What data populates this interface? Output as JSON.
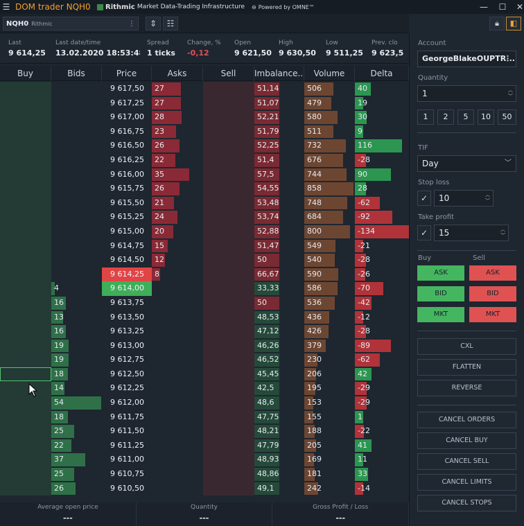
{
  "titlebar": {
    "menu_icon": "hamburger-icon",
    "title": "DOM trader NQH0",
    "rithmic_brand": "Rithmic",
    "rithmic_tagline": "Market Data-Trading Infrastructure",
    "omne": "Powered by OMNE™"
  },
  "toolbar": {
    "symbol": "NQH0",
    "connection": "Rithmic"
  },
  "stats": [
    {
      "label": "Last",
      "value": "9 614,25"
    },
    {
      "label": "Last date/time",
      "value": "13.02.2020 18:53:48"
    },
    {
      "label": "Spread",
      "value": "1 ticks"
    },
    {
      "label": "Change, %",
      "value": "-0,12"
    },
    {
      "label": "Open",
      "value": "9 621,50"
    },
    {
      "label": "High",
      "value": "9 630,50"
    },
    {
      "label": "Low",
      "value": "9 511,25"
    },
    {
      "label": "Prev. clo",
      "value": "9 623,5"
    }
  ],
  "columns": [
    "Buy",
    "Bids",
    "Price",
    "Asks",
    "Sell",
    "Imbalance...",
    "Volume",
    "Delta"
  ],
  "colors": {
    "ask_bar": "#8a2a36",
    "bid_bar": "#2f7048",
    "imb_bar": "#7a2a32",
    "vol_bar": "#6d4632",
    "delta_pos": "#2c9650",
    "delta_neg": "#b0333a",
    "last_price": "#e04545",
    "best_bid": "#3fae58"
  },
  "rows": [
    {
      "price": "9 617,50",
      "bids": "",
      "asks": "27",
      "imb": "51,14",
      "vol": "506",
      "delta": "40"
    },
    {
      "price": "9 617,25",
      "bids": "",
      "asks": "27",
      "imb": "51,07",
      "vol": "479",
      "delta": "19"
    },
    {
      "price": "9 617,00",
      "bids": "",
      "asks": "28",
      "imb": "52,21",
      "vol": "580",
      "delta": "30"
    },
    {
      "price": "9 616,75",
      "bids": "",
      "asks": "23",
      "imb": "51,79",
      "vol": "511",
      "delta": "9"
    },
    {
      "price": "9 616,50",
      "bids": "",
      "asks": "26",
      "imb": "52,25",
      "vol": "732",
      "delta": "116"
    },
    {
      "price": "9 616,25",
      "bids": "",
      "asks": "22",
      "imb": "51,4",
      "vol": "676",
      "delta": "-28"
    },
    {
      "price": "9 616,00",
      "bids": "",
      "asks": "35",
      "imb": "57,5",
      "vol": "744",
      "delta": "90"
    },
    {
      "price": "9 615,75",
      "bids": "",
      "asks": "26",
      "imb": "54,55",
      "vol": "858",
      "delta": "28"
    },
    {
      "price": "9 615,50",
      "bids": "",
      "asks": "21",
      "imb": "53,48",
      "vol": "748",
      "delta": "-62"
    },
    {
      "price": "9 615,25",
      "bids": "",
      "asks": "24",
      "imb": "53,74",
      "vol": "684",
      "delta": "-92"
    },
    {
      "price": "9 615,00",
      "bids": "",
      "asks": "20",
      "imb": "52,88",
      "vol": "800",
      "delta": "-134"
    },
    {
      "price": "9 614,75",
      "bids": "",
      "asks": "15",
      "imb": "51,47",
      "vol": "549",
      "delta": "-21"
    },
    {
      "price": "9 614,50",
      "bids": "",
      "asks": "12",
      "imb": "50",
      "vol": "540",
      "delta": "-28"
    },
    {
      "price": "9 614,25",
      "bids": "",
      "asks": "8",
      "imb": "66,67",
      "vol": "590",
      "delta": "-26",
      "hl": "last"
    },
    {
      "price": "9 614,00",
      "bids": "4",
      "asks": "",
      "imb": "33,33",
      "vol": "586",
      "delta": "-70",
      "hl": "bid"
    },
    {
      "price": "9 613,75",
      "bids": "16",
      "asks": "",
      "imb": "50",
      "vol": "536",
      "delta": "-42"
    },
    {
      "price": "9 613,50",
      "bids": "13",
      "asks": "",
      "imb": "48,53",
      "vol": "436",
      "delta": "-12"
    },
    {
      "price": "9 613,25",
      "bids": "16",
      "asks": "",
      "imb": "47,12",
      "vol": "426",
      "delta": "-28"
    },
    {
      "price": "9 613,00",
      "bids": "19",
      "asks": "",
      "imb": "46,26",
      "vol": "379",
      "delta": "-89"
    },
    {
      "price": "9 612,75",
      "bids": "19",
      "asks": "",
      "imb": "46,52",
      "vol": "230",
      "delta": "-62"
    },
    {
      "price": "9 612,50",
      "bids": "18",
      "asks": "",
      "imb": "45,45",
      "vol": "206",
      "delta": "42",
      "sel": true
    },
    {
      "price": "9 612,25",
      "bids": "14",
      "asks": "",
      "imb": "42,5",
      "vol": "195",
      "delta": "-29"
    },
    {
      "price": "9 612,00",
      "bids": "54",
      "asks": "",
      "imb": "48,6",
      "vol": "153",
      "delta": "-29"
    },
    {
      "price": "9 611,75",
      "bids": "18",
      "asks": "",
      "imb": "47,75",
      "vol": "155",
      "delta": "1"
    },
    {
      "price": "9 611,50",
      "bids": "25",
      "asks": "",
      "imb": "48,21",
      "vol": "188",
      "delta": "-22"
    },
    {
      "price": "9 611,25",
      "bids": "22",
      "asks": "",
      "imb": "47,79",
      "vol": "205",
      "delta": "41"
    },
    {
      "price": "9 611,00",
      "bids": "37",
      "asks": "",
      "imb": "48,93",
      "vol": "169",
      "delta": "11"
    },
    {
      "price": "9 610,75",
      "bids": "25",
      "asks": "",
      "imb": "48,86",
      "vol": "181",
      "delta": "33"
    },
    {
      "price": "9 610,50",
      "bids": "26",
      "asks": "",
      "imb": "49,1",
      "vol": "242",
      "delta": "-14"
    }
  ],
  "footer": [
    {
      "label": "Average open price",
      "value": "---"
    },
    {
      "label": "Quantity",
      "value": "---"
    },
    {
      "label": "Gross Profit / Loss",
      "value": "---"
    }
  ],
  "side": {
    "account_label": "Account",
    "account_value": "GeorgeBlakeOUPTR...",
    "quantity_label": "Quantity",
    "quantity_value": "1",
    "qty_presets": [
      "1",
      "2",
      "5",
      "10",
      "50"
    ],
    "tif_label": "TIF",
    "tif_value": "Day",
    "stop_loss_label": "Stop loss",
    "stop_loss_value": "10",
    "take_profit_label": "Take profit",
    "take_profit_value": "15",
    "buy_label": "Buy",
    "sell_label": "Sell",
    "order_buttons": [
      "ASK",
      "BID",
      "MKT"
    ],
    "actions": [
      "CXL",
      "FLATTEN",
      "REVERSE"
    ],
    "cancel_actions": [
      "CANCEL ORDERS",
      "CANCEL BUY",
      "CANCEL SELL",
      "CANCEL LIMITS",
      "CANCEL STOPS"
    ]
  }
}
